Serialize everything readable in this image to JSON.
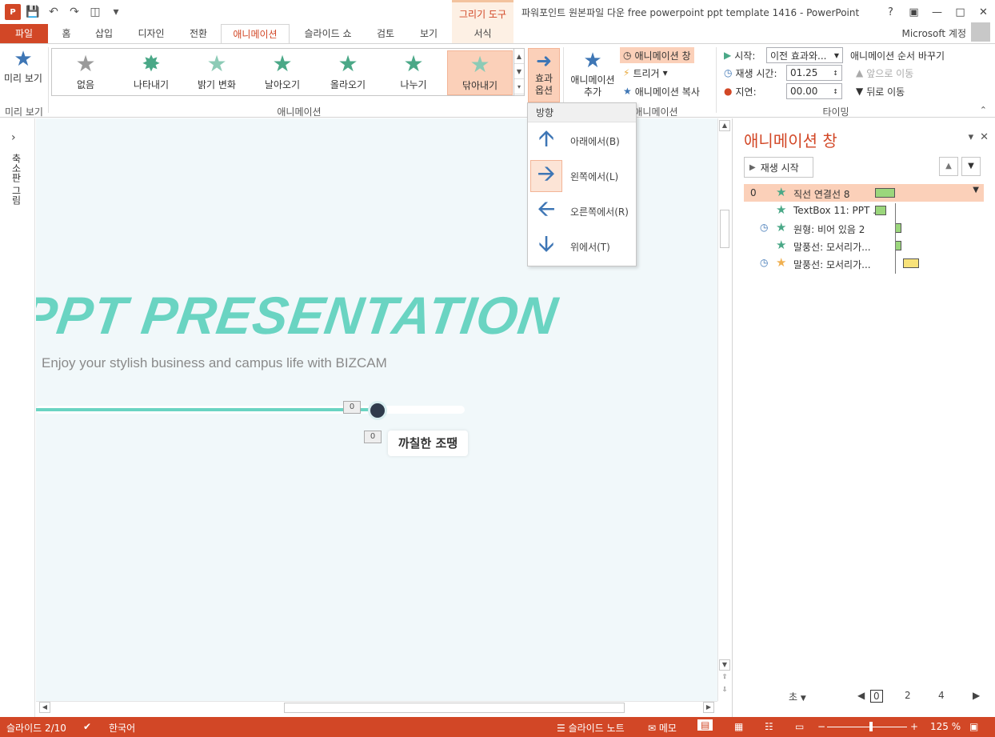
{
  "title_bar": {
    "context_tool": "그리기 도구",
    "document_title": "파워포인트 원본파일 다운 free powerpoint ppt template 1416 - PowerPoint",
    "help": "?",
    "account": "Microsoft 계정"
  },
  "tabs": {
    "file": "파일",
    "home": "홈",
    "insert": "삽입",
    "design": "디자인",
    "transitions": "전환",
    "animations": "애니메이션",
    "slideshow": "슬라이드 쇼",
    "review": "검토",
    "view": "보기",
    "format": "서식"
  },
  "ribbon": {
    "preview": {
      "label": "미리 보기",
      "group": "미리 보기"
    },
    "gallery": {
      "group": "애니메이션",
      "items": [
        {
          "label": "없음"
        },
        {
          "label": "나타내기"
        },
        {
          "label": "밝기 변화"
        },
        {
          "label": "날아오기"
        },
        {
          "label": "올라오기"
        },
        {
          "label": "나누기"
        },
        {
          "label": "닦아내기"
        }
      ]
    },
    "effect_options": "효과 옵션",
    "add_animation": "애니메이션 추가",
    "animation_pane_btn": "애니메이션 창",
    "trigger": "트리거",
    "animation_painter": "애니메이션 복사",
    "advanced_group": "애니메이션",
    "timing": {
      "group": "타이밍",
      "start_label": "시작:",
      "start_value": "이전 효과와...",
      "duration_label": "재생 시간:",
      "duration_value": "01.25",
      "delay_label": "지연:",
      "delay_value": "00.00",
      "reorder": "애니메이션 순서 바꾸기",
      "move_earlier": "앞으로 이동",
      "move_later": "뒤로 이동"
    }
  },
  "dropdown": {
    "header": "방향",
    "items": [
      {
        "label": "아래에서(B)",
        "icon": "arrow-up-icon"
      },
      {
        "label": "왼쪽에서(L)",
        "icon": "arrow-right-icon"
      },
      {
        "label": "오른쪽에서(R)",
        "icon": "arrow-left-icon"
      },
      {
        "label": "위에서(T)",
        "icon": "arrow-down-icon"
      }
    ]
  },
  "left_rail": {
    "label": "축소판 그림"
  },
  "slide": {
    "title": "PPT PRESENTATION",
    "subtitle": "Enjoy your stylish business and campus life with BIZCAM",
    "badge1": "0",
    "badge2": "0",
    "tooltip": "까칠한 조땡",
    "progress": 0.78
  },
  "animation_pane": {
    "title": "애니메이션 창",
    "play": "재생 시작",
    "rows": [
      {
        "num": "0",
        "label": "직선 연결선 8",
        "clock": false
      },
      {
        "num": "",
        "label": "TextBox 11: PPT ...",
        "clock": false
      },
      {
        "num": "",
        "label": "원형: 비어 있음 2",
        "clock": true
      },
      {
        "num": "",
        "label": "말풍선: 모서리가...",
        "clock": false
      },
      {
        "num": "",
        "label": "말풍선: 모서리가...",
        "clock": true
      }
    ],
    "seconds": "초",
    "ruler": [
      "0",
      "2",
      "4"
    ]
  },
  "status_bar": {
    "slide": "슬라이드 2/10",
    "language": "한국어",
    "notes": "슬라이드 노트",
    "comments": "메모",
    "zoom": "125 %"
  },
  "colors": {
    "accent": "#d24726",
    "teal": "#6ad4c2",
    "selected": "#fbd0b9"
  }
}
